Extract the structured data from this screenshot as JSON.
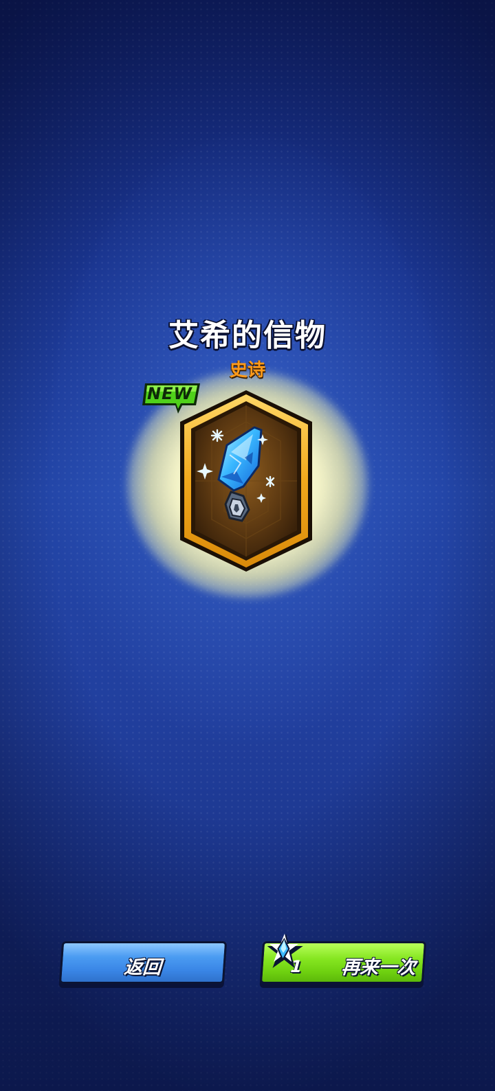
{
  "reward": {
    "item_name": "艾希的信物",
    "rarity": "史诗",
    "new_badge": "NEW",
    "item_icon": "blue-crystal-pendant-icon"
  },
  "actions": {
    "back_label": "返回",
    "again_label": "再来一次",
    "again_cost": "1",
    "again_cost_icon": "star-crystal-icon"
  },
  "colors": {
    "rarity": "#ff9a1a",
    "back_button": "#3a86e6",
    "again_button": "#6ed010",
    "new_badge": "#4fd11a",
    "card_frame": "#f2b22a"
  }
}
